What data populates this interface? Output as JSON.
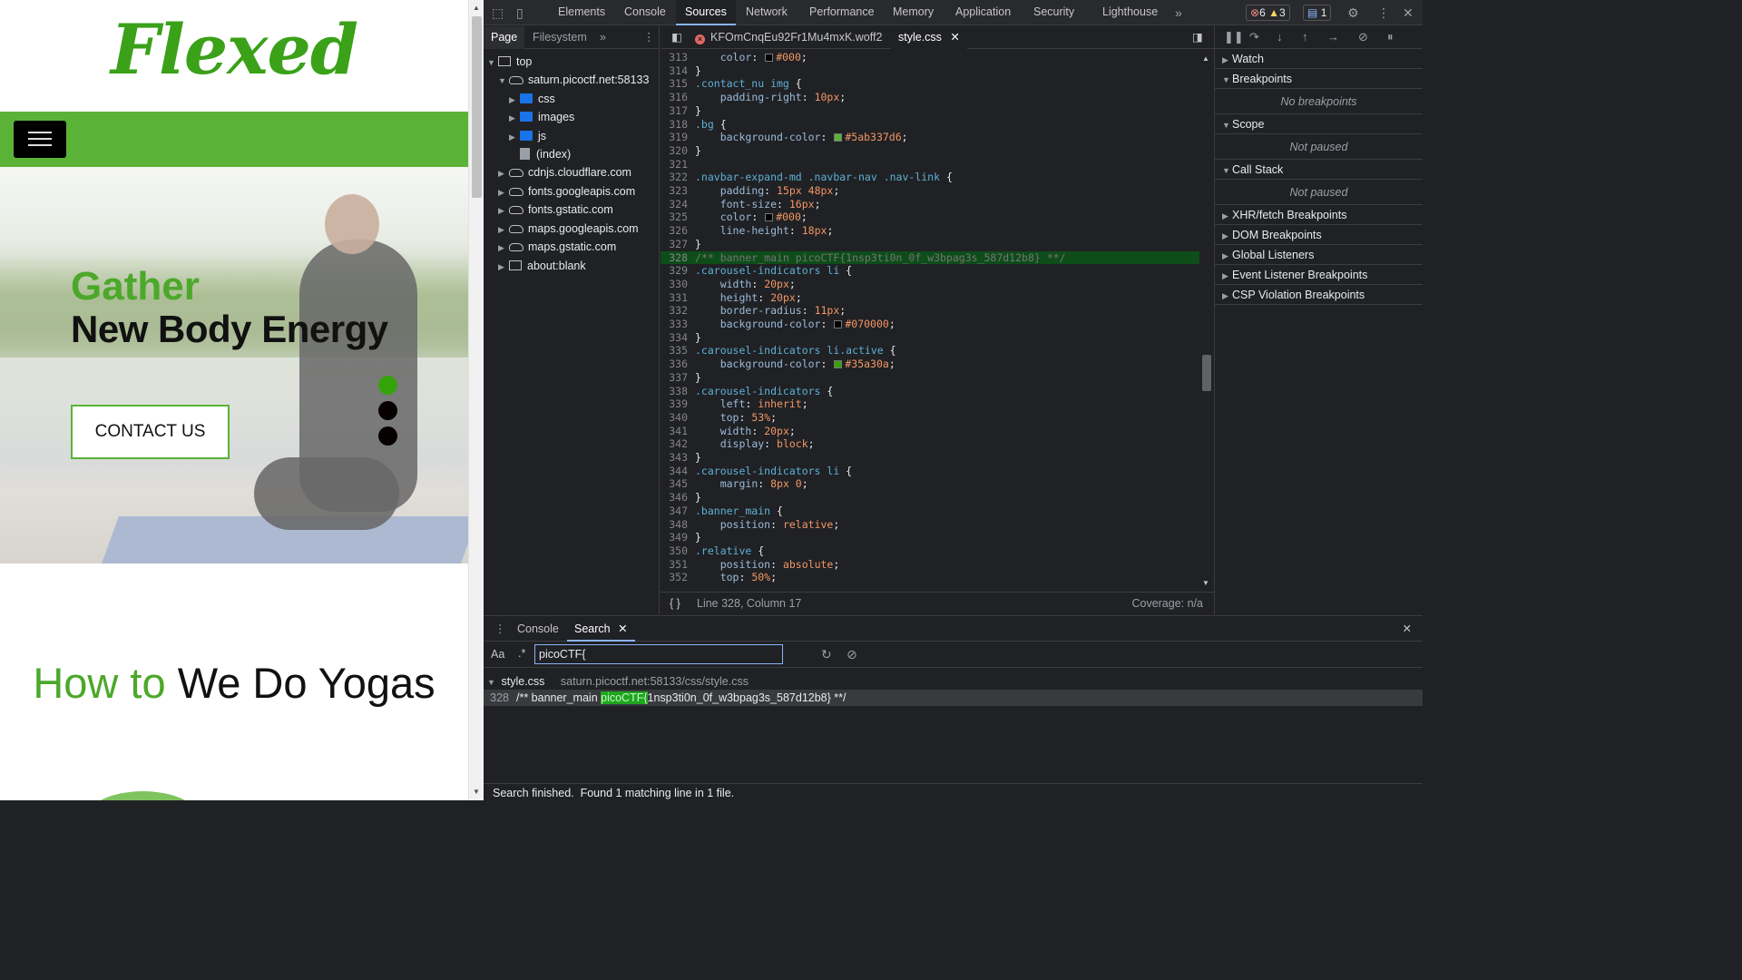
{
  "site": {
    "logo": "Flexed",
    "banner": {
      "heading_green": "Gather",
      "heading_dark": "New Body Energy",
      "cta_label": "CONTACT US"
    },
    "section_title_green": "How to",
    "section_title_dark": "We Do Yogas",
    "colors": {
      "brand_green": "#5ab337",
      "heading_green": "#4ca82a",
      "indicator_active": "#35a30a",
      "indicator": "#070000"
    }
  },
  "devtools": {
    "tabs": [
      "Elements",
      "Console",
      "Sources",
      "Network",
      "Performance",
      "Memory",
      "Application",
      "Security",
      "Lighthouse"
    ],
    "active_tab": "Sources",
    "more_tabs_icon": "chevron-double-right-icon",
    "counts": {
      "errors": "6",
      "warnings": "3",
      "messages": "1"
    },
    "navigator": {
      "tabs": [
        "Page",
        "Filesystem"
      ],
      "tree": [
        {
          "label": "top",
          "type": "frame"
        },
        {
          "label": "saturn.picoctf.net:58133",
          "type": "cloud"
        },
        {
          "label": "css",
          "type": "folder"
        },
        {
          "label": "images",
          "type": "folder"
        },
        {
          "label": "js",
          "type": "folder"
        },
        {
          "label": "(index)",
          "type": "file"
        },
        {
          "label": "cdnjs.cloudflare.com",
          "type": "cloud"
        },
        {
          "label": "fonts.googleapis.com",
          "type": "cloud"
        },
        {
          "label": "fonts.gstatic.com",
          "type": "cloud"
        },
        {
          "label": "maps.googleapis.com",
          "type": "cloud"
        },
        {
          "label": "maps.gstatic.com",
          "type": "cloud"
        },
        {
          "label": "about:blank",
          "type": "frame"
        }
      ]
    },
    "editor": {
      "tabs": [
        {
          "label": "KFOmCnqEu92Fr1Mu4mxK.woff2",
          "error": true
        },
        {
          "label": "style.css",
          "active": true
        }
      ],
      "status_position": "Line 328, Column 17",
      "status_coverage": "Coverage: n/a",
      "lines": [
        {
          "n": "313",
          "parts": [
            [
              "p",
              "    "
            ],
            [
              "k",
              "color"
            ],
            [
              "p",
              ": "
            ],
            [
              "sw",
              "#000000"
            ],
            [
              "v",
              "#000"
            ],
            [
              "p",
              ";"
            ]
          ]
        },
        {
          "n": "314",
          "parts": [
            [
              "p",
              "}"
            ]
          ]
        },
        {
          "n": "315",
          "parts": [
            [
              "s",
              ".contact_nu img"
            ],
            [
              "p",
              " {"
            ]
          ]
        },
        {
          "n": "316",
          "parts": [
            [
              "p",
              "    "
            ],
            [
              "k",
              "padding-right"
            ],
            [
              "p",
              ": "
            ],
            [
              "v",
              "10px"
            ],
            [
              "p",
              ";"
            ]
          ]
        },
        {
          "n": "317",
          "parts": [
            [
              "p",
              "}"
            ]
          ]
        },
        {
          "n": "318",
          "parts": [
            [
              "s",
              ".bg"
            ],
            [
              "p",
              " {"
            ]
          ]
        },
        {
          "n": "319",
          "parts": [
            [
              "p",
              "    "
            ],
            [
              "k",
              "background-color"
            ],
            [
              "p",
              ": "
            ],
            [
              "sw",
              "#5ab337"
            ],
            [
              "v",
              "#5ab337d6"
            ],
            [
              "p",
              ";"
            ]
          ]
        },
        {
          "n": "320",
          "parts": [
            [
              "p",
              "}"
            ]
          ]
        },
        {
          "n": "321",
          "parts": []
        },
        {
          "n": "322",
          "parts": [
            [
              "s",
              ".navbar-expand-md .navbar-nav .nav-link"
            ],
            [
              "p",
              " {"
            ]
          ]
        },
        {
          "n": "323",
          "parts": [
            [
              "p",
              "    "
            ],
            [
              "k",
              "padding"
            ],
            [
              "p",
              ": "
            ],
            [
              "v",
              "15px 48px"
            ],
            [
              "p",
              ";"
            ]
          ]
        },
        {
          "n": "324",
          "parts": [
            [
              "p",
              "    "
            ],
            [
              "k",
              "font-size"
            ],
            [
              "p",
              ": "
            ],
            [
              "v",
              "16px"
            ],
            [
              "p",
              ";"
            ]
          ]
        },
        {
          "n": "325",
          "parts": [
            [
              "p",
              "    "
            ],
            [
              "k",
              "color"
            ],
            [
              "p",
              ": "
            ],
            [
              "sw",
              "#000000"
            ],
            [
              "v",
              "#000"
            ],
            [
              "p",
              ";"
            ]
          ]
        },
        {
          "n": "326",
          "parts": [
            [
              "p",
              "    "
            ],
            [
              "k",
              "line-height"
            ],
            [
              "p",
              ": "
            ],
            [
              "v",
              "18px"
            ],
            [
              "p",
              ";"
            ]
          ]
        },
        {
          "n": "327",
          "parts": [
            [
              "p",
              "}"
            ]
          ]
        },
        {
          "n": "328",
          "hl": true,
          "parts": [
            [
              "c",
              "/** banner_main picoCTF{1nsp3ti0n_0f_w3bpag3s_587d12b8} **/"
            ]
          ]
        },
        {
          "n": "329",
          "parts": [
            [
              "s",
              ".carousel-indicators li"
            ],
            [
              "p",
              " {"
            ]
          ]
        },
        {
          "n": "330",
          "parts": [
            [
              "p",
              "    "
            ],
            [
              "k",
              "width"
            ],
            [
              "p",
              ": "
            ],
            [
              "v",
              "20px"
            ],
            [
              "p",
              ";"
            ]
          ]
        },
        {
          "n": "331",
          "parts": [
            [
              "p",
              "    "
            ],
            [
              "k",
              "height"
            ],
            [
              "p",
              ": "
            ],
            [
              "v",
              "20px"
            ],
            [
              "p",
              ";"
            ]
          ]
        },
        {
          "n": "332",
          "parts": [
            [
              "p",
              "    "
            ],
            [
              "k",
              "border-radius"
            ],
            [
              "p",
              ": "
            ],
            [
              "v",
              "11px"
            ],
            [
              "p",
              ";"
            ]
          ]
        },
        {
          "n": "333",
          "parts": [
            [
              "p",
              "    "
            ],
            [
              "k",
              "background-color"
            ],
            [
              "p",
              ": "
            ],
            [
              "sw",
              "#070000"
            ],
            [
              "v",
              "#070000"
            ],
            [
              "p",
              ";"
            ]
          ]
        },
        {
          "n": "334",
          "parts": [
            [
              "p",
              "}"
            ]
          ]
        },
        {
          "n": "335",
          "parts": [
            [
              "s",
              ".carousel-indicators li.active"
            ],
            [
              "p",
              " {"
            ]
          ]
        },
        {
          "n": "336",
          "parts": [
            [
              "p",
              "    "
            ],
            [
              "k",
              "background-color"
            ],
            [
              "p",
              ": "
            ],
            [
              "sw",
              "#35a30a"
            ],
            [
              "v",
              "#35a30a"
            ],
            [
              "p",
              ";"
            ]
          ]
        },
        {
          "n": "337",
          "parts": [
            [
              "p",
              "}"
            ]
          ]
        },
        {
          "n": "338",
          "parts": [
            [
              "s",
              ".carousel-indicators"
            ],
            [
              "p",
              " {"
            ]
          ]
        },
        {
          "n": "339",
          "parts": [
            [
              "p",
              "    "
            ],
            [
              "k",
              "left"
            ],
            [
              "p",
              ": "
            ],
            [
              "v",
              "inherit"
            ],
            [
              "p",
              ";"
            ]
          ]
        },
        {
          "n": "340",
          "parts": [
            [
              "p",
              "    "
            ],
            [
              "k",
              "top"
            ],
            [
              "p",
              ": "
            ],
            [
              "v",
              "53%"
            ],
            [
              "p",
              ";"
            ]
          ]
        },
        {
          "n": "341",
          "parts": [
            [
              "p",
              "    "
            ],
            [
              "k",
              "width"
            ],
            [
              "p",
              ": "
            ],
            [
              "v",
              "20px"
            ],
            [
              "p",
              ";"
            ]
          ]
        },
        {
          "n": "342",
          "parts": [
            [
              "p",
              "    "
            ],
            [
              "k",
              "display"
            ],
            [
              "p",
              ": "
            ],
            [
              "v",
              "block"
            ],
            [
              "p",
              ";"
            ]
          ]
        },
        {
          "n": "343",
          "parts": [
            [
              "p",
              "}"
            ]
          ]
        },
        {
          "n": "344",
          "parts": [
            [
              "s",
              ".carousel-indicators li"
            ],
            [
              "p",
              " {"
            ]
          ]
        },
        {
          "n": "345",
          "parts": [
            [
              "p",
              "    "
            ],
            [
              "k",
              "margin"
            ],
            [
              "p",
              ": "
            ],
            [
              "v",
              "8px 0"
            ],
            [
              "p",
              ";"
            ]
          ]
        },
        {
          "n": "346",
          "parts": [
            [
              "p",
              "}"
            ]
          ]
        },
        {
          "n": "347",
          "parts": [
            [
              "s",
              ".banner_main"
            ],
            [
              "p",
              " {"
            ]
          ]
        },
        {
          "n": "348",
          "parts": [
            [
              "p",
              "    "
            ],
            [
              "k",
              "position"
            ],
            [
              "p",
              ": "
            ],
            [
              "v",
              "relative"
            ],
            [
              "p",
              ";"
            ]
          ]
        },
        {
          "n": "349",
          "parts": [
            [
              "p",
              "}"
            ]
          ]
        },
        {
          "n": "350",
          "parts": [
            [
              "s",
              ".relative"
            ],
            [
              "p",
              " {"
            ]
          ]
        },
        {
          "n": "351",
          "parts": [
            [
              "p",
              "    "
            ],
            [
              "k",
              "position"
            ],
            [
              "p",
              ": "
            ],
            [
              "v",
              "absolute"
            ],
            [
              "p",
              ";"
            ]
          ]
        },
        {
          "n": "352",
          "parts": [
            [
              "p",
              "    "
            ],
            [
              "k",
              "top"
            ],
            [
              "p",
              ": "
            ],
            [
              "v",
              "50%"
            ],
            [
              "p",
              ";"
            ]
          ]
        }
      ]
    },
    "debugger": {
      "panes": [
        {
          "title": "Watch",
          "open": false
        },
        {
          "title": "Breakpoints",
          "open": true,
          "body": "No breakpoints"
        },
        {
          "title": "Scope",
          "open": true,
          "body": "Not paused"
        },
        {
          "title": "Call Stack",
          "open": true,
          "body": "Not paused"
        },
        {
          "title": "XHR/fetch Breakpoints",
          "open": false
        },
        {
          "title": "DOM Breakpoints",
          "open": false
        },
        {
          "title": "Global Listeners",
          "open": false
        },
        {
          "title": "Event Listener Breakpoints",
          "open": false
        },
        {
          "title": "CSP Violation Breakpoints",
          "open": false
        }
      ]
    },
    "drawer": {
      "tabs": [
        "Console",
        "Search"
      ],
      "active_tab": "Search",
      "case_toggle": "Aa",
      "regex_toggle": ".*",
      "query": "picoCTF{",
      "result_file": "style.css",
      "result_path": "saturn.picoctf.net:58133/css/style.css",
      "result_line_no": "328",
      "result_prefix": "/** banner_main ",
      "result_match": "picoCTF{",
      "result_suffix": "1nsp3ti0n_0f_w3bpag3s_587d12b8} **/",
      "status": "Search finished.  Found 1 matching line in 1 file."
    }
  }
}
